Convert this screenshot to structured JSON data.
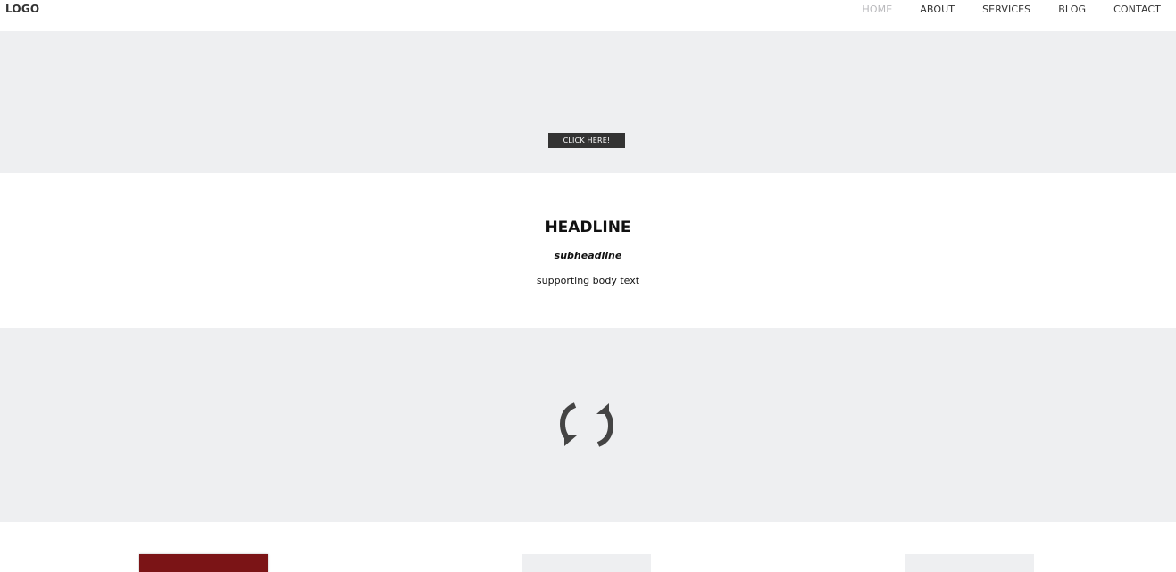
{
  "header": {
    "logo": "LOGO",
    "nav": [
      {
        "label": "HOME",
        "active": true
      },
      {
        "label": "ABOUT",
        "active": false
      },
      {
        "label": "SERVICES",
        "active": false
      },
      {
        "label": "BLOG",
        "active": false
      },
      {
        "label": "CONTACT",
        "active": false
      }
    ]
  },
  "hero": {
    "button_label": "CLICK HERE!"
  },
  "content": {
    "headline": "HEADLINE",
    "subheadline": "subheadline",
    "body": "supporting body text"
  },
  "media": {
    "icon": "reload-icon"
  },
  "cards": [
    {
      "color": "#7b1416"
    },
    {
      "color": "#eeeff1"
    },
    {
      "color": "#eeeff1"
    }
  ],
  "colors": {
    "accent": "#7b1416",
    "section_bg": "#eeeff1",
    "button_bg": "#333333",
    "nav_active": "#b9b9bc"
  }
}
